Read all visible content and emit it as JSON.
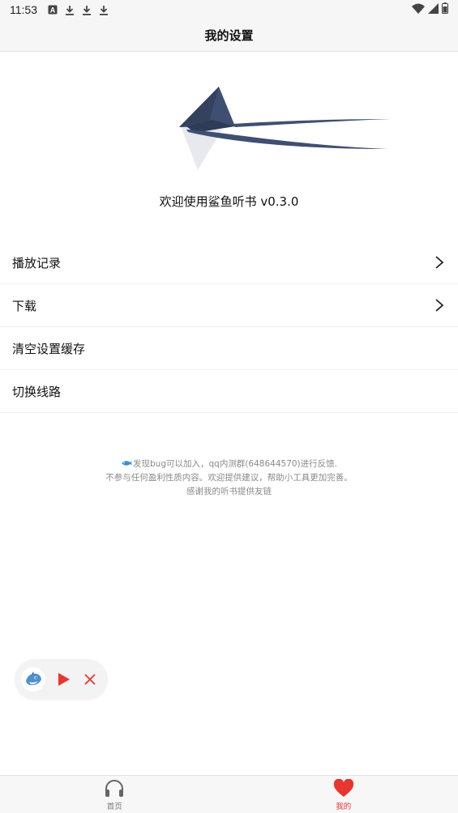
{
  "status_bar": {
    "time": "11:53",
    "icons": [
      "font-icon",
      "download-icon",
      "download-icon",
      "download-icon"
    ],
    "right_icons": [
      "wifi-icon",
      "signal-icon",
      "battery-icon"
    ]
  },
  "header": {
    "title": "我的设置"
  },
  "welcome": {
    "text": "欢迎使用鲨鱼听书 v0.3.0"
  },
  "menu": {
    "items": [
      {
        "label": "播放记录",
        "has_arrow": true
      },
      {
        "label": "下载",
        "has_arrow": true
      },
      {
        "label": "清空设置缓存",
        "has_arrow": false
      },
      {
        "label": "切换线路",
        "has_arrow": false
      }
    ]
  },
  "note": {
    "line1": "发现bug可以加入，qq内测群(648644570)进行反馈.",
    "line2": "不参与任何盈利性质内容。欢迎提供建议，帮助小工具更加完善。",
    "line3": "感谢我的听书提供友链"
  },
  "tabs": [
    {
      "label": "首页",
      "icon": "headphones-icon",
      "active": false
    },
    {
      "label": "我的",
      "icon": "heart-icon",
      "active": true
    }
  ],
  "colors": {
    "accent": "#e8352f",
    "logo": "#3f4f72",
    "muted": "#8a8a8a"
  }
}
